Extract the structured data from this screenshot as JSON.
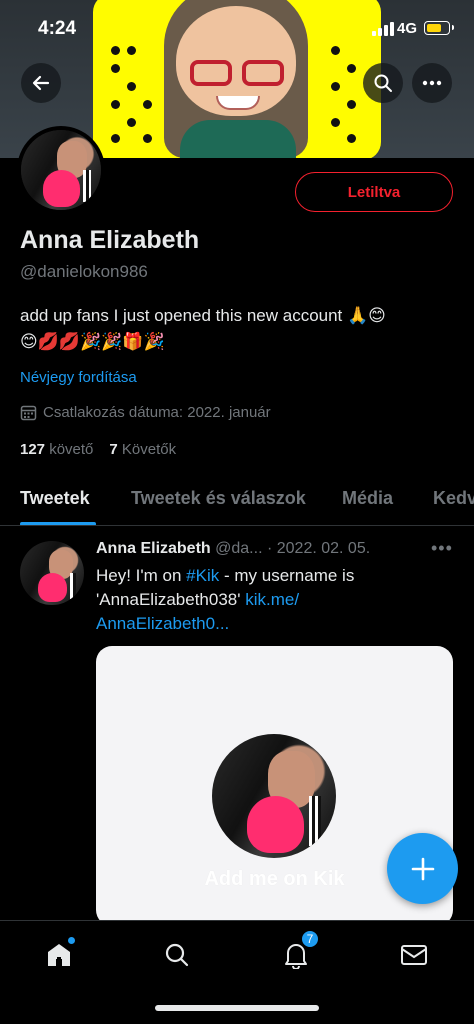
{
  "status_bar": {
    "time": "4:24",
    "network": "4G",
    "battery_level": 0.7,
    "battery_color": "#ffd60a"
  },
  "header": {
    "back_icon": "arrow-left-icon",
    "search_icon": "search-icon",
    "more_icon": "more-horizontal-icon"
  },
  "profile": {
    "name": "Anna Elizabeth",
    "handle": "@danielokon986",
    "blocked_label": "Letiltva",
    "bio_line1": "add up fans I just opened this new account 🙏😊",
    "bio_line2": "😊💋💋🎉🎉🎁🎉",
    "translate_label": "Névjegy fordítása",
    "joined": "Csatlakozás dátuma: 2022. január",
    "following_count": "127",
    "following_label": "követő",
    "followers_count": "7",
    "followers_label": "Követők"
  },
  "tabs": [
    {
      "label": "Tweetek",
      "active": true
    },
    {
      "label": "Tweetek és válaszok",
      "active": false
    },
    {
      "label": "Média",
      "active": false
    },
    {
      "label": "Kedv",
      "active": false
    }
  ],
  "tweet": {
    "name": "Anna Elizabeth",
    "handle": "@da...",
    "date": "· 2022. 02. 05.",
    "more": "•••",
    "text_part1": "Hey! I'm on ",
    "hashtag": "#Kik",
    "text_part2": " - my username is 'AnnaElizabeth038' ",
    "link": "kik.me/ AnnaElizabeth0...",
    "card_caption": "Add me on Kik"
  },
  "bottom_nav": {
    "items": [
      "home-icon",
      "search-icon",
      "notifications-icon",
      "messages-icon"
    ],
    "notification_count": "7"
  },
  "colors": {
    "accent": "#1d9bf0",
    "danger": "#f4212e",
    "background": "#000000",
    "text_secondary": "#71767b"
  }
}
